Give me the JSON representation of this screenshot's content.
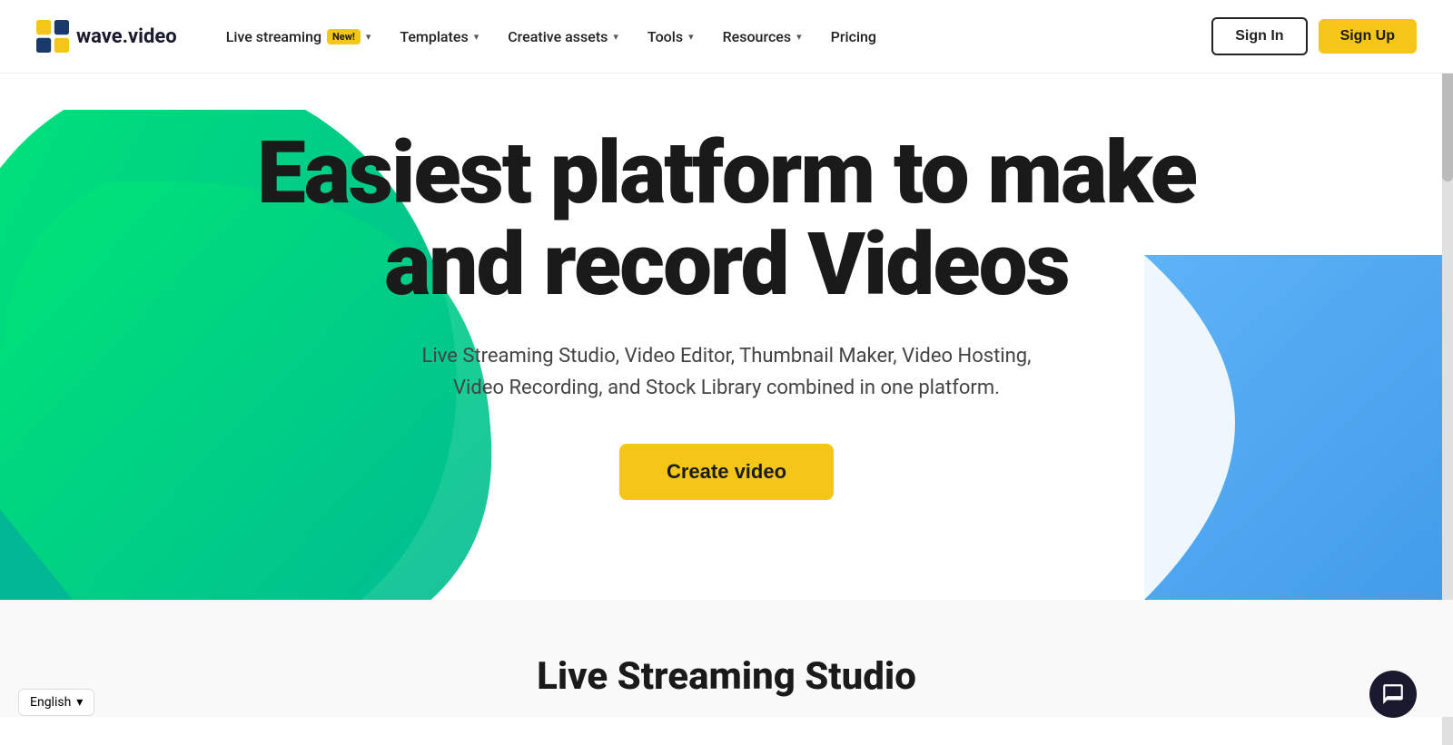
{
  "logo": {
    "text": "wave.video",
    "icon_color_primary": "#f5c518",
    "icon_color_secondary": "#1a3a6b"
  },
  "nav": {
    "items": [
      {
        "id": "live-streaming",
        "label": "Live streaming",
        "badge": "New!",
        "has_chevron": true
      },
      {
        "id": "templates",
        "label": "Templates",
        "has_chevron": true
      },
      {
        "id": "creative-assets",
        "label": "Creative assets",
        "has_chevron": true
      },
      {
        "id": "tools",
        "label": "Tools",
        "has_chevron": true
      },
      {
        "id": "resources",
        "label": "Resources",
        "has_chevron": true
      },
      {
        "id": "pricing",
        "label": "Pricing",
        "has_chevron": false
      }
    ],
    "sign_in": "Sign In",
    "sign_up": "Sign Up"
  },
  "hero": {
    "title_line1": "Easiest platform to make",
    "title_line2": "and record Videos",
    "subtitle": "Live Streaming Studio, Video Editor, Thumbnail Maker, Video Hosting, Video Recording, and Stock Library combined in one platform.",
    "cta": "Create video",
    "colors": {
      "green_blob": "#00cc88",
      "blue_shape": "#3399ff",
      "teal_triangle": "#00aa77",
      "cta_bg": "#f5c518"
    }
  },
  "section_below": {
    "title": "Live Streaming Studio"
  },
  "chat": {
    "icon_label": "chat-icon"
  },
  "language": {
    "current": "English",
    "chevron": "▾"
  }
}
